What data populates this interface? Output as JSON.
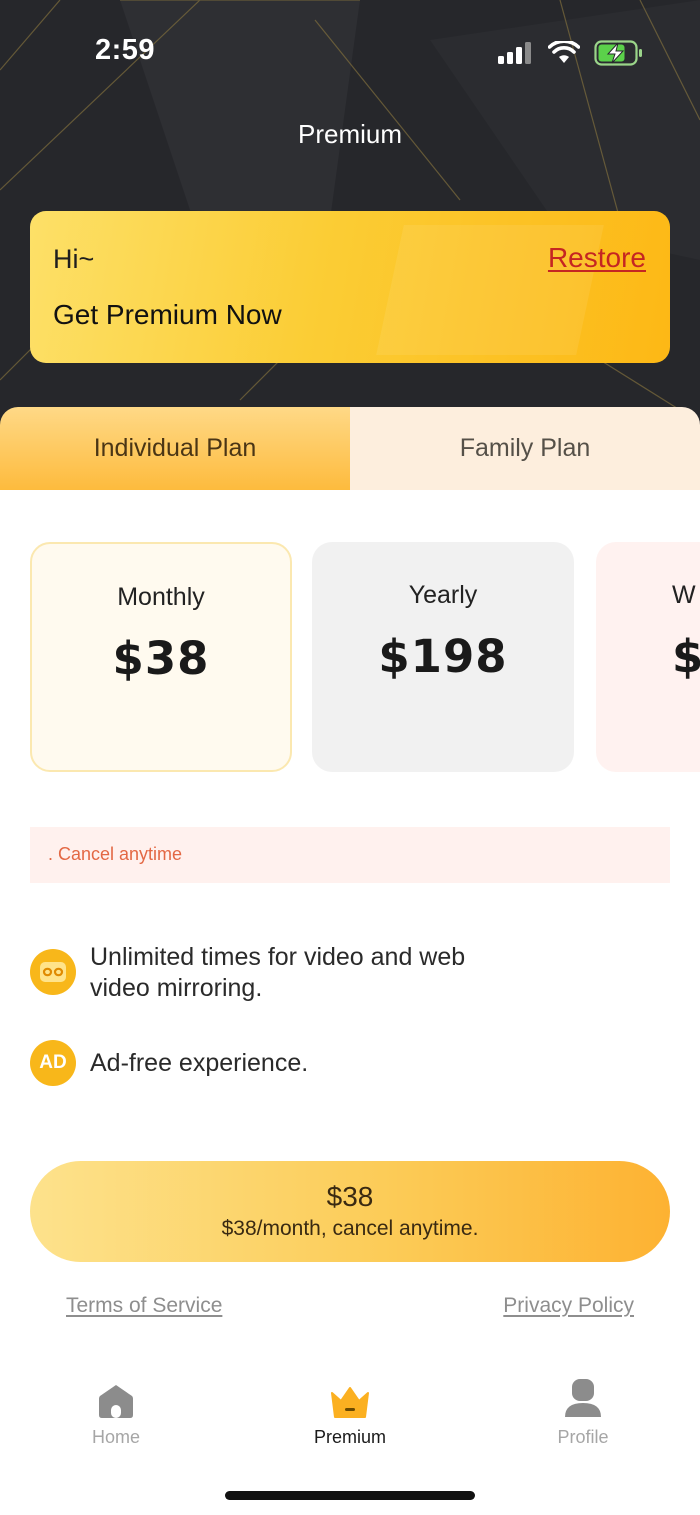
{
  "status_bar": {
    "time": "2:59",
    "icons": [
      "cellular-signal-icon",
      "wifi-icon",
      "battery-charging-icon"
    ]
  },
  "header": {
    "title": "Premium"
  },
  "promo": {
    "greeting": "Hi~",
    "headline": "Get Premium Now",
    "restore_label": "Restore"
  },
  "tabs": [
    {
      "label": "Individual Plan",
      "active": true
    },
    {
      "label": "Family Plan",
      "active": false
    }
  ],
  "plans": [
    {
      "name": "Monthly",
      "price": "$38",
      "selected": true
    },
    {
      "name": "Yearly",
      "price": "$198",
      "selected": false
    },
    {
      "name": "W",
      "price": "$",
      "selected": false
    }
  ],
  "note": ". Cancel anytime",
  "features": [
    {
      "icon": "infinity-icon",
      "text": "Unlimited times for video and web video mirroring."
    },
    {
      "icon": "ad-icon",
      "icon_text": "AD",
      "text": "Ad-free experience."
    }
  ],
  "cta": {
    "price": "$38",
    "subtitle": "$38/month, cancel anytime."
  },
  "links": {
    "terms": "Terms of Service",
    "privacy": "Privacy Policy"
  },
  "bottom_nav": [
    {
      "label": "Home",
      "icon": "home-icon",
      "active": false
    },
    {
      "label": "Premium",
      "icon": "crown-icon",
      "active": true
    },
    {
      "label": "Profile",
      "icon": "profile-icon",
      "active": false
    }
  ],
  "colors": {
    "header_bg": "#26272b",
    "accent": "#fdb815",
    "restore": "#c52622",
    "note_text": "#e36844"
  }
}
